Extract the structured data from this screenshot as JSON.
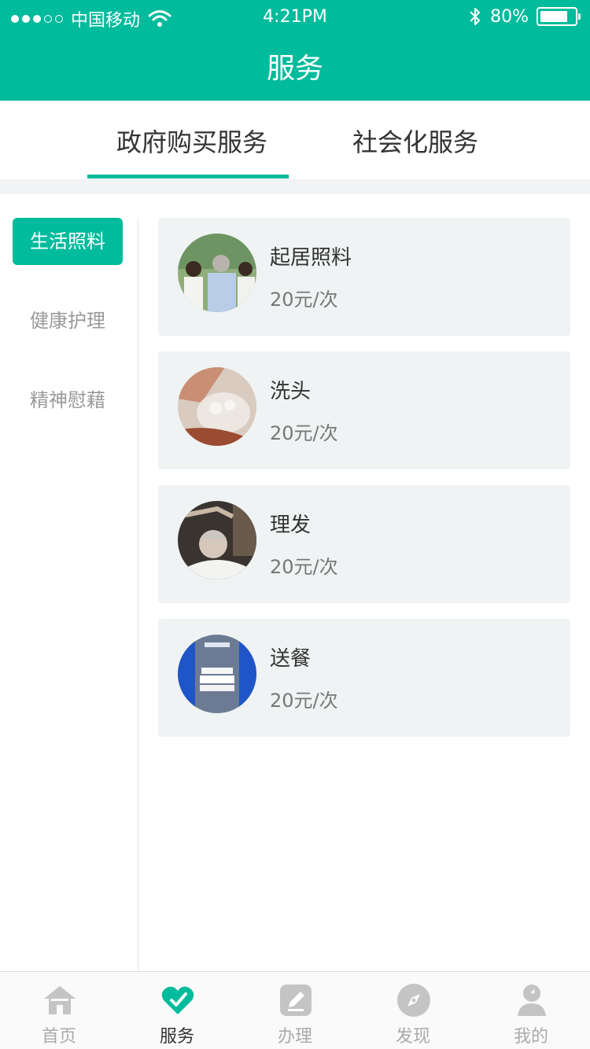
{
  "status_bar": {
    "carrier": "中国移动",
    "time": "4:21PM",
    "battery_percent": "80%",
    "battery_level": 0.8
  },
  "header": {
    "title": "服务"
  },
  "tabs": [
    {
      "label": "政府购买服务",
      "active": true
    },
    {
      "label": "社会化服务",
      "active": false
    }
  ],
  "categories": [
    {
      "label": "生活照料",
      "active": true
    },
    {
      "label": "健康护理",
      "active": false
    },
    {
      "label": "精神慰藉",
      "active": false
    }
  ],
  "services": [
    {
      "name": "起居照料",
      "price": "20元/次",
      "image": "caregivers-photo"
    },
    {
      "name": "洗头",
      "price": "20元/次",
      "image": "hair-washing-photo"
    },
    {
      "name": "理发",
      "price": "20元/次",
      "image": "haircut-photo"
    },
    {
      "name": "送餐",
      "price": "20元/次",
      "image": "meal-delivery-photo"
    }
  ],
  "bottom_nav": [
    {
      "label": "首页",
      "icon": "home-icon",
      "active": false
    },
    {
      "label": "服务",
      "icon": "heart-icon",
      "active": true
    },
    {
      "label": "办理",
      "icon": "edit-icon",
      "active": false
    },
    {
      "label": "发现",
      "icon": "compass-icon",
      "active": false
    },
    {
      "label": "我的",
      "icon": "user-icon",
      "active": false
    }
  ],
  "colors": {
    "accent": "#00bb9c",
    "card_bg": "#f0f3f4",
    "inactive": "#aaaaaa"
  }
}
